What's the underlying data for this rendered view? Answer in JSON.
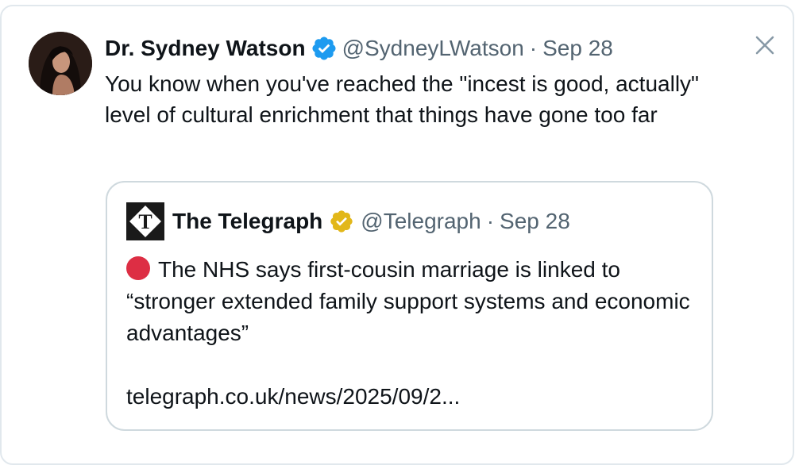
{
  "tweet": {
    "author": {
      "display_name": "Dr. Sydney Watson",
      "handle": "@SydneyLWatson",
      "verified": "blue-check",
      "avatar_icon": "profile-photo"
    },
    "separator": "·",
    "date": "Sep 28",
    "text": "You know when you've reached the \"incest is good, actually\" level of cultural enrichment that things have gone too far",
    "close_icon": "close-icon"
  },
  "quoted_tweet": {
    "author": {
      "display_name": "The Telegraph",
      "handle": "@Telegraph",
      "verified": "gold-check",
      "avatar_icon": "telegraph-logo"
    },
    "separator": "·",
    "date": "Sep 28",
    "text": "The NHS says first-cousin marriage is linked to “stronger extended family support systems and economic advantages”",
    "link": "telegraph.co.uk/news/2025/09/2...",
    "bullet_icon": "red-circle-icon"
  },
  "colors": {
    "text": "#0f1419",
    "muted": "#536471",
    "blue_check": "#1d9bf0",
    "gold_check": "#e2b719",
    "red_circle": "#dd2e44",
    "border": "#cfd9de"
  }
}
